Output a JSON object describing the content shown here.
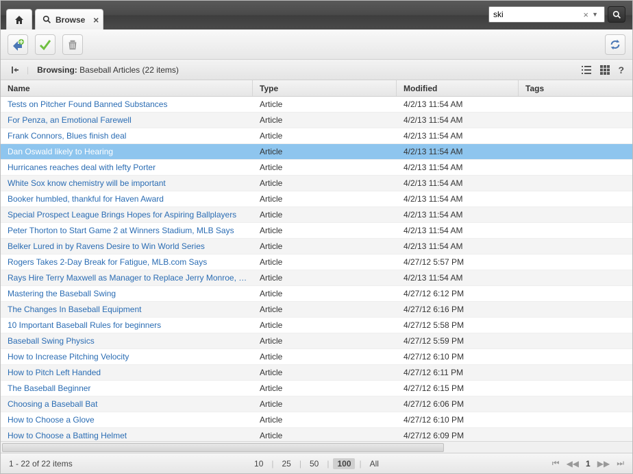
{
  "tab": {
    "title": "Browse"
  },
  "search": {
    "value": "ski"
  },
  "breadcrumb": {
    "label": "Browsing:",
    "path": "Baseball Articles (22 items)"
  },
  "columns": {
    "name": "Name",
    "type": "Type",
    "modified": "Modified",
    "tags": "Tags"
  },
  "rows": [
    {
      "name": "Tests on Pitcher Found Banned Substances",
      "type": "Article",
      "modified": "4/2/13 11:54 AM",
      "selected": false
    },
    {
      "name": "For Penza, an Emotional Farewell",
      "type": "Article",
      "modified": "4/2/13 11:54 AM",
      "selected": false
    },
    {
      "name": "Frank Connors, Blues finish deal",
      "type": "Article",
      "modified": "4/2/13 11:54 AM",
      "selected": false
    },
    {
      "name": "Dan Oswald likely to Hearing",
      "type": "Article",
      "modified": "4/2/13 11:54 AM",
      "selected": true
    },
    {
      "name": "Hurricanes reaches deal with lefty Porter",
      "type": "Article",
      "modified": "4/2/13 11:54 AM",
      "selected": false
    },
    {
      "name": "White Sox know chemistry will be important",
      "type": "Article",
      "modified": "4/2/13 11:54 AM",
      "selected": false
    },
    {
      "name": "Booker humbled, thankful for Haven Award",
      "type": "Article",
      "modified": "4/2/13 11:54 AM",
      "selected": false
    },
    {
      "name": "Special Prospect League Brings Hopes for Aspiring Ballplayers",
      "type": "Article",
      "modified": "4/2/13 11:54 AM",
      "selected": false
    },
    {
      "name": "Peter Thorton to Start Game 2 at Winners Stadium, MLB Says",
      "type": "Article",
      "modified": "4/2/13 11:54 AM",
      "selected": false
    },
    {
      "name": "Belker Lured in by Ravens Desire to Win World Series",
      "type": "Article",
      "modified": "4/2/13 11:54 AM",
      "selected": false
    },
    {
      "name": "Rogers Takes 2-Day Break for Fatigue, MLB.com Says",
      "type": "Article",
      "modified": "4/27/12 5:57 PM",
      "selected": false
    },
    {
      "name": "Rays Hire Terry Maxwell as Manager to Replace Jerry Monroe, MLB.",
      "type": "Article",
      "modified": "4/2/13 11:54 AM",
      "selected": false
    },
    {
      "name": "Mastering the Baseball Swing",
      "type": "Article",
      "modified": "4/27/12 6:12 PM",
      "selected": false
    },
    {
      "name": "The Changes In Baseball Equipment",
      "type": "Article",
      "modified": "4/27/12 6:16 PM",
      "selected": false
    },
    {
      "name": "10 Important Baseball Rules for beginners",
      "type": "Article",
      "modified": "4/27/12 5:58 PM",
      "selected": false
    },
    {
      "name": "Baseball Swing Physics",
      "type": "Article",
      "modified": "4/27/12 5:59 PM",
      "selected": false
    },
    {
      "name": "How to Increase Pitching Velocity",
      "type": "Article",
      "modified": "4/27/12 6:10 PM",
      "selected": false
    },
    {
      "name": "How to Pitch Left Handed",
      "type": "Article",
      "modified": "4/27/12 6:11 PM",
      "selected": false
    },
    {
      "name": "The Baseball Beginner",
      "type": "Article",
      "modified": "4/27/12 6:15 PM",
      "selected": false
    },
    {
      "name": "Choosing a Baseball Bat",
      "type": "Article",
      "modified": "4/27/12 6:06 PM",
      "selected": false
    },
    {
      "name": "How to Choose a Glove",
      "type": "Article",
      "modified": "4/27/12 6:10 PM",
      "selected": false
    },
    {
      "name": "How to Choose a Batting Helmet",
      "type": "Article",
      "modified": "4/27/12 6:09 PM",
      "selected": false
    }
  ],
  "footer": {
    "status": "1 - 22 of 22 items",
    "page_sizes": [
      "10",
      "25",
      "50",
      "100",
      "All"
    ],
    "active_size": "100",
    "current_page": "1"
  }
}
